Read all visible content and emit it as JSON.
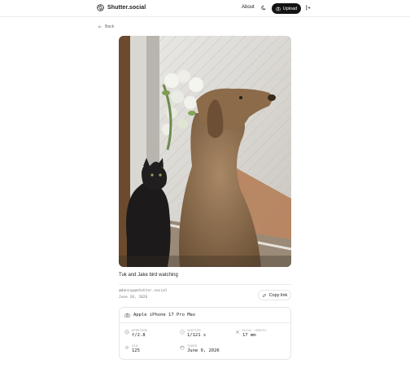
{
  "header": {
    "brand": "Shutter.social",
    "nav_about": "About",
    "upload_label": "Upload"
  },
  "back_label": "Back",
  "photo": {
    "caption": "Tuk and Jake bird watching",
    "author": "@dansup@shutter.social",
    "date": "June 10, 2026"
  },
  "actions": {
    "copy_link": "Copy link"
  },
  "exif": {
    "camera": "Apple iPhone 17 Pro Max",
    "aperture": {
      "label": "APERTURE",
      "value": "f/2.8"
    },
    "shutter": {
      "label": "SHUTTER",
      "value": "1/121 s"
    },
    "focal_length": {
      "label": "FOCAL LENGTH",
      "value": "17 mm"
    },
    "iso": {
      "label": "ISO",
      "value": "125"
    },
    "taken": {
      "label": "TAKEN",
      "value": "June 9, 2026"
    }
  },
  "icons": {
    "logo": "aperture-icon",
    "theme": "moon-icon",
    "upload": "camera-icon",
    "signout": "sign-out-icon",
    "back": "arrow-left-icon",
    "copy": "link-icon"
  },
  "colors": {
    "accent": "#141414",
    "muted": "#777777",
    "border": "#e6e6e6"
  }
}
